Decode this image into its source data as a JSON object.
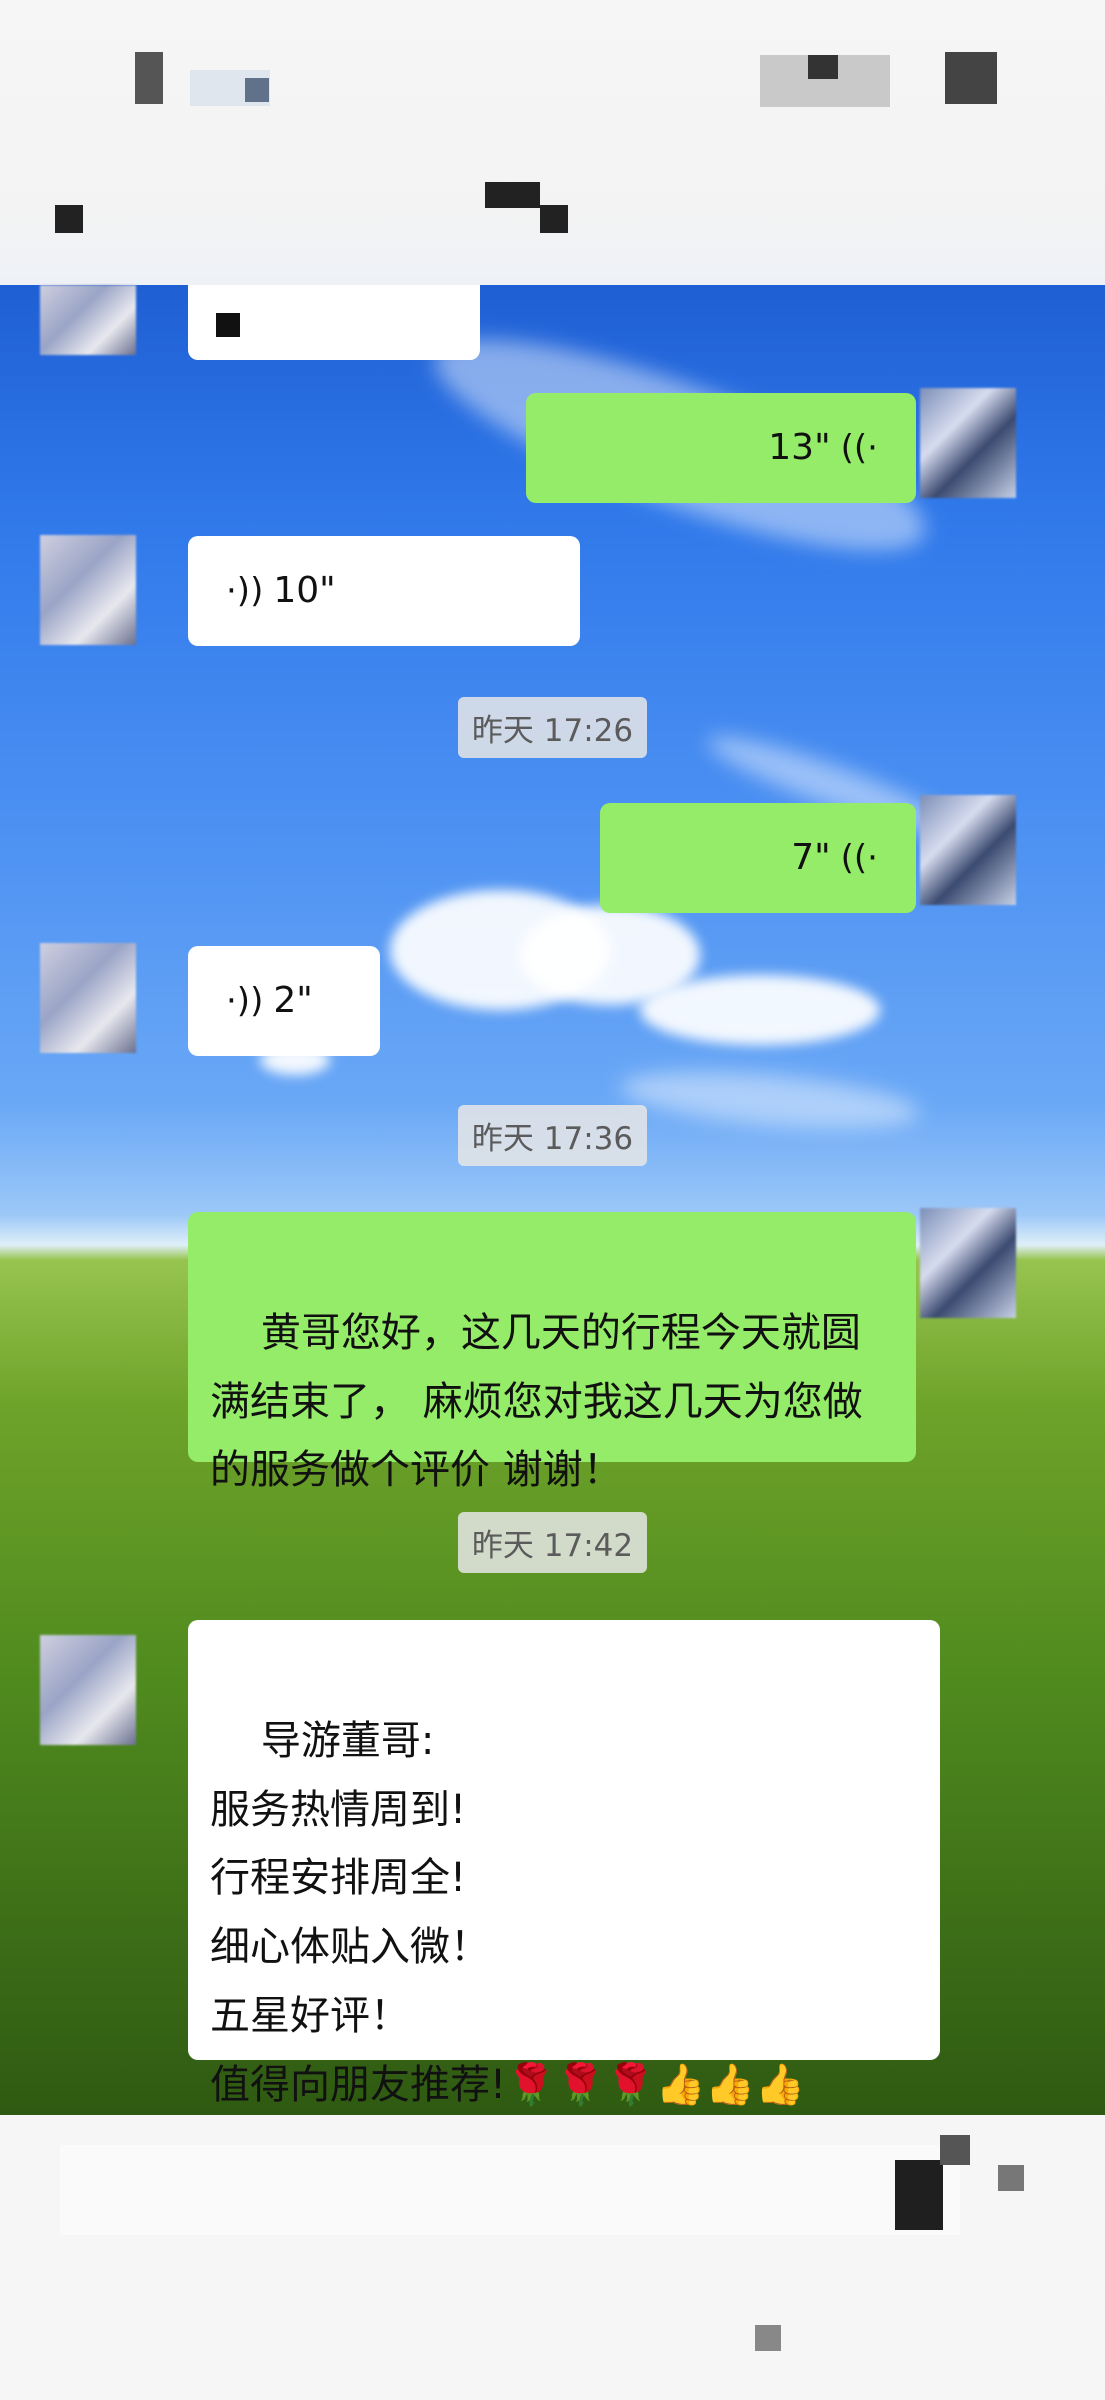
{
  "messages": [
    {
      "type": "voice",
      "side": "me",
      "duration": "13\""
    },
    {
      "type": "voice",
      "side": "other",
      "duration": "10\""
    },
    {
      "type": "timestamp",
      "text": "昨天 17:26"
    },
    {
      "type": "voice",
      "side": "me",
      "duration": "7\""
    },
    {
      "type": "voice",
      "side": "other",
      "duration": "2\""
    },
    {
      "type": "timestamp",
      "text": "昨天 17:36"
    },
    {
      "type": "text",
      "side": "me",
      "text": "黄哥您好，这几天的行程今天就圆满结束了， 麻烦您对我这几天为您做的服务做个评价 谢谢！"
    },
    {
      "type": "timestamp",
      "text": "昨天 17:42"
    },
    {
      "type": "text",
      "side": "other",
      "text": "导游董哥:\n服务热情周到!\n行程安排周全!\n细心体贴入微！\n五星好评！\n值得向朋友推荐!🌹🌹🌹👍👍👍"
    }
  ],
  "icons": {
    "voice_wave_me": "voice-wave-icon",
    "voice_wave_other": "voice-wave-icon"
  },
  "colors": {
    "my_bubble": "#95ec69",
    "other_bubble": "#ffffff",
    "timestamp_bg": "#e6e6e6"
  }
}
